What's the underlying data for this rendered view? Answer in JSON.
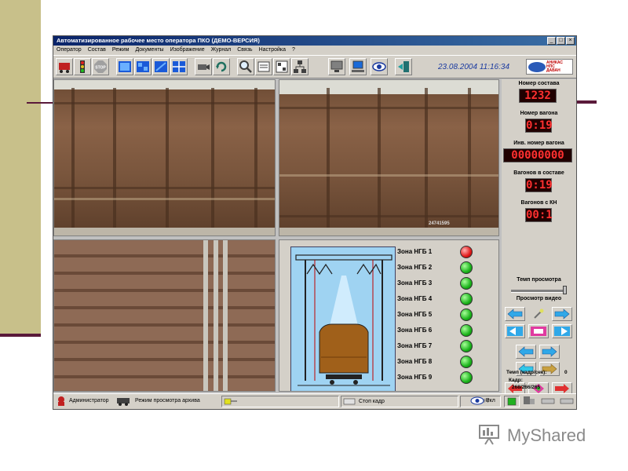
{
  "window": {
    "title": "Автоматизированное рабочее место оператора ПКО (ДЕМО-ВЕРСИЯ)",
    "minimize": "_",
    "maximize": "□",
    "close": "×"
  },
  "menu": [
    "Оператор",
    "Состав",
    "Режим",
    "Документы",
    "Изображение",
    "Журнал",
    "Связь",
    "Настройка",
    "?"
  ],
  "toolbar": {
    "datetime": "23.08.2004 11:16:34",
    "logo_text": [
      "АНИКАС",
      "НПС",
      "ДАВАН"
    ],
    "icons": [
      "wagon-icon",
      "traffic-light-icon",
      "stop-icon",
      "layout-1-icon",
      "layout-2-icon",
      "layout-3-icon",
      "layout-4-icon",
      "camera-icon",
      "rotate-icon",
      "magnifier-icon",
      "document-icon",
      "list-icon",
      "network-icon",
      "monitor-icon",
      "computer-icon",
      "eye-icon",
      "exit-icon"
    ]
  },
  "side": {
    "train_number_label": "Номер состава",
    "train_number": "1232",
    "wagon_number_label": "Номер вагона",
    "wagon_number": "0:19",
    "inv_number_label": "Инв. номер вагона",
    "inv_number": "00000000",
    "wagons_total_label": "Вагонов в составе",
    "wagons_total": "0:19",
    "wagons_kn_label": "Вагонов с КН",
    "wagons_kn": "00:1",
    "speed_label": "Темп просмотра",
    "video_label": "Просмотр видео",
    "rate_label": "Темп (кадр/сек):",
    "rate_value": "0",
    "frame_label": "Кадр:",
    "frame_value": "268/266/265"
  },
  "zones": [
    {
      "label": "Зона НГБ 1",
      "status": "red"
    },
    {
      "label": "Зона НГБ 2",
      "status": "green"
    },
    {
      "label": "Зона НГБ 3",
      "status": "green"
    },
    {
      "label": "Зона НГБ 4",
      "status": "green"
    },
    {
      "label": "Зона НГБ 5",
      "status": "green"
    },
    {
      "label": "Зона НГБ 6",
      "status": "green"
    },
    {
      "label": "Зона НГБ 7",
      "status": "green"
    },
    {
      "label": "Зона НГБ 8",
      "status": "green"
    },
    {
      "label": "Зона НГБ 9",
      "status": "green"
    }
  ],
  "status": {
    "user": "Администратор",
    "mode": "Режим просмотра архива",
    "stop_frame": "Стоп кадр",
    "prg": "ПРГ",
    "on": "Вкл"
  },
  "video_overlays": {
    "tr_number": "24741595"
  },
  "watermark": "MyShared",
  "colors": {
    "titlebar": "#0a246a",
    "led_text": "#ff3030",
    "led_bg": "#200000",
    "zone_green": "#1bb31b",
    "zone_red": "#e01a1a",
    "datetime": "#1a3aa0"
  }
}
